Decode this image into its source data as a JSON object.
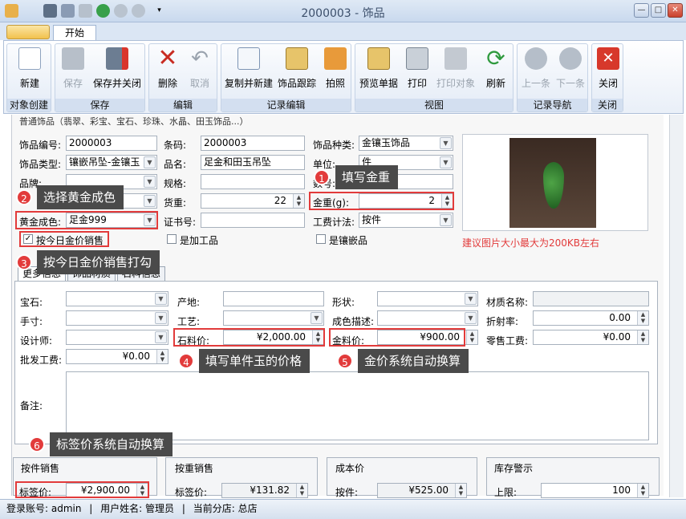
{
  "window": {
    "title": "2000003 - 饰品",
    "min": "—",
    "max": "□",
    "close": "✕"
  },
  "ribbon": {
    "tab_home": "开始",
    "groups": [
      {
        "label": "对象创建",
        "buttons": [
          "新建"
        ]
      },
      {
        "label": "保存",
        "buttons": [
          "保存",
          "保存并关闭"
        ]
      },
      {
        "label": "编辑",
        "buttons": [
          "删除",
          "取消"
        ]
      },
      {
        "label": "记录编辑",
        "buttons": [
          "复制并新建",
          "饰品跟踪",
          "拍照"
        ]
      },
      {
        "label": "视图",
        "buttons": [
          "预览单据",
          "打印",
          "打印对象",
          "刷新"
        ]
      },
      {
        "label": "记录导航",
        "buttons": [
          "上一条",
          "下一条"
        ]
      },
      {
        "label": "关闭",
        "buttons": [
          "关闭"
        ]
      }
    ]
  },
  "form": {
    "section_title": "普通饰品（翡翠、彩宝、宝石、珍珠、水晶、田玉饰品...）",
    "item_no_label": "饰品编号:",
    "item_no": "2000003",
    "barcode_label": "条码:",
    "barcode": "2000003",
    "category_label": "饰品种类:",
    "category": "金镶玉饰品",
    "type_label": "饰品类型:",
    "type": "镶嵌吊坠-金镶玉",
    "name_label": "品名:",
    "name": "足金和田玉吊坠",
    "unit_label": "单位:",
    "unit": "件",
    "brand_label": "品牌:",
    "spec_label": "规格:",
    "count_label": "数号:",
    "goods_weight_label": "货重:",
    "goods_weight": "22",
    "gold_weight_label": "金重(g):",
    "gold_weight": "2",
    "gold_fineness_label": "黄金成色:",
    "gold_fineness": "足金999",
    "cert_label": "证书号:",
    "labor_method_label": "工费计法:",
    "labor_method": "按件",
    "daily_price_label": "按今日金价销售",
    "processed_label": "是加工品",
    "inlaid_label": "是镶嵌品",
    "image_hint": "建议图片大小最大为200KB左右"
  },
  "tabs": [
    "更多信息",
    "饰品材质",
    "石料信息"
  ],
  "more": {
    "gem_label": "宝石:",
    "origin_label": "产地:",
    "shape_label": "形状:",
    "material_label": "材质名称:",
    "size_label": "手寸:",
    "craft_label": "工艺:",
    "color_desc_label": "成色描述:",
    "refraction_label": "折射率:",
    "refraction": "0.00",
    "designer_label": "设计师:",
    "stone_price_label": "石料价:",
    "stone_price": "¥2,000.00",
    "gold_price_label": "金料价:",
    "gold_price": "¥900.00",
    "retail_fee_label": "零售工费:",
    "retail_fee": "¥0.00",
    "wholesale_fee_label": "批发工费:",
    "wholesale_fee": "¥0.00",
    "remark_label": "备注:"
  },
  "bottom": {
    "piece_title": "按件销售",
    "tag_price_label": "标签价:",
    "tag_price": "¥2,900.00",
    "weight_title": "按重销售",
    "weight_tag_label": "标签价:",
    "weight_tag": "¥131.82",
    "cost_title": "成本价",
    "cost_piece_label": "按件:",
    "cost_piece": "¥525.00",
    "stock_title": "库存警示",
    "stock_upper_label": "上限:",
    "stock_upper": "100"
  },
  "callouts": [
    {
      "num": "1",
      "text": "填写金重"
    },
    {
      "num": "2",
      "text": "选择黄金成色"
    },
    {
      "num": "3",
      "text": "按今日金价销售打勾"
    },
    {
      "num": "4",
      "text": "填写单件玉的价格"
    },
    {
      "num": "5",
      "text": "金价系统自动换算"
    },
    {
      "num": "6",
      "text": "标签价系统自动换算"
    }
  ],
  "status": {
    "account": "登录账号: admin",
    "user": "用户姓名: 管理员",
    "branch": "当前分店: 总店",
    "divider": "|"
  }
}
